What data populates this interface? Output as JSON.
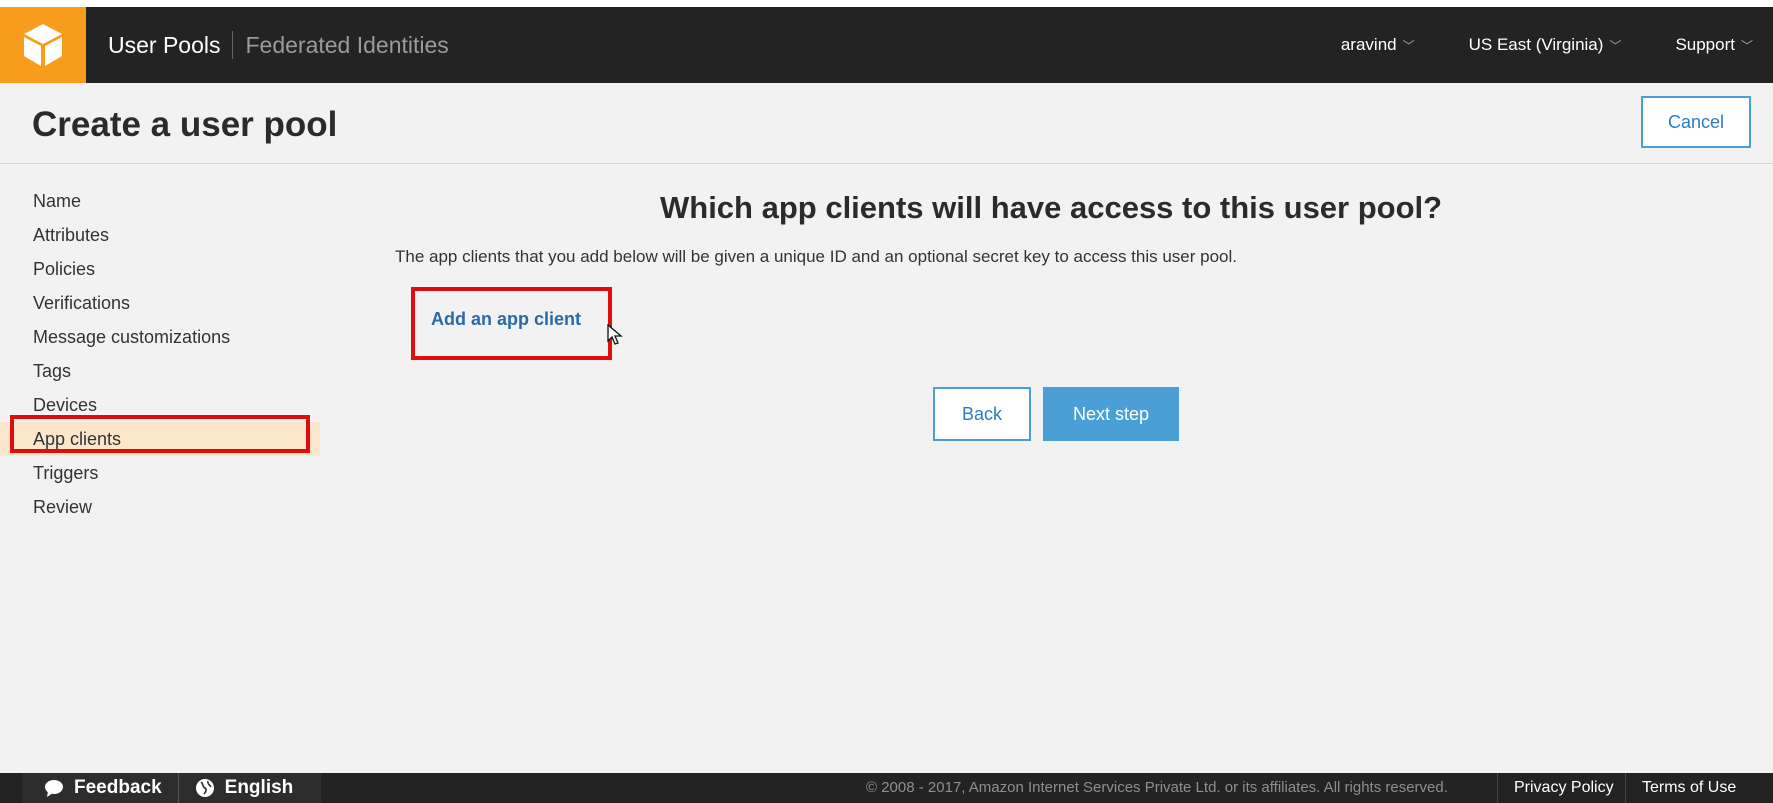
{
  "topbar": {
    "primary_nav": "User Pools",
    "secondary_nav": "Federated Identities",
    "user_menu": "aravind",
    "region_menu": "US East (Virginia)",
    "support_menu": "Support",
    "brand_color": "#f89c1b"
  },
  "page": {
    "title": "Create a user pool",
    "cancel_label": "Cancel"
  },
  "sidebar": {
    "items": [
      {
        "label": "Name"
      },
      {
        "label": "Attributes"
      },
      {
        "label": "Policies"
      },
      {
        "label": "Verifications"
      },
      {
        "label": "Message customizations"
      },
      {
        "label": "Tags"
      },
      {
        "label": "Devices"
      },
      {
        "label": "App clients"
      },
      {
        "label": "Triggers"
      },
      {
        "label": "Review"
      }
    ],
    "active_index": 7,
    "active_color": "#fbe6cb"
  },
  "main": {
    "heading": "Which app clients will have access to this user pool?",
    "description": "The app clients that you add below will be given a unique ID and an optional secret key to access this user pool.",
    "add_client_link": "Add an app client",
    "back_label": "Back",
    "next_label": "Next step",
    "highlight_color": "#e00d0d"
  },
  "footer": {
    "feedback_label": "Feedback",
    "language_label": "English",
    "copyright": "© 2008 - 2017, Amazon Internet Services Private Ltd. or its affiliates. All rights reserved.",
    "privacy_label": "Privacy Policy",
    "terms_label": "Terms of Use"
  }
}
